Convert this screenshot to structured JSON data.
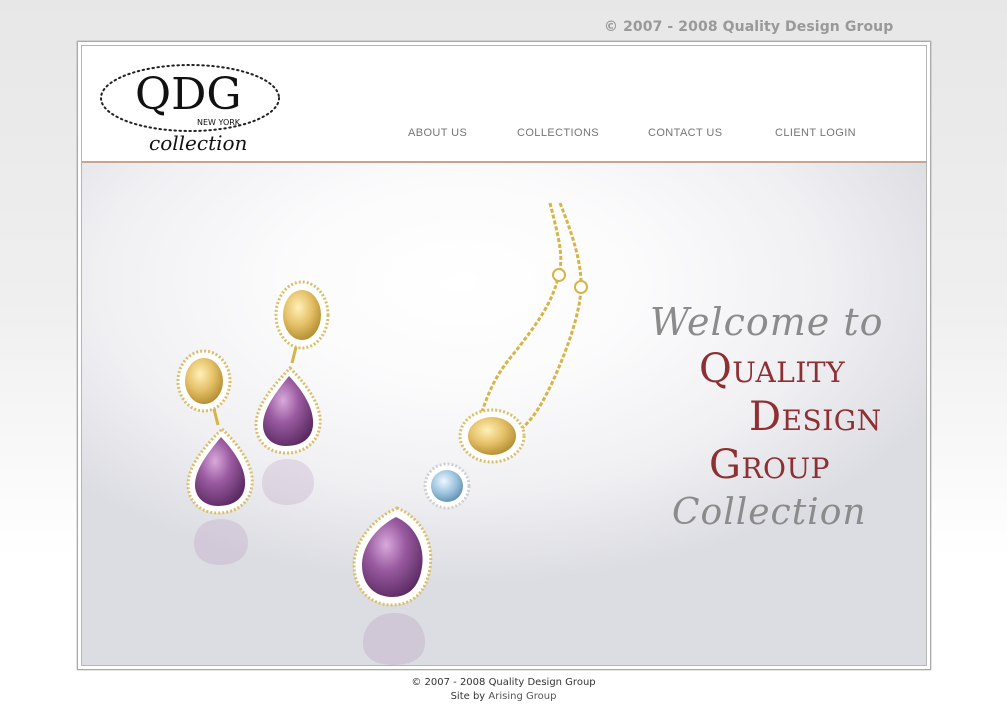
{
  "top_copyright": "© 2007 - 2008 Quality Design Group",
  "logo": {
    "letters": "QDG",
    "city": "NEW YORK",
    "sub": "collection"
  },
  "nav": [
    {
      "label": "ABOUT US"
    },
    {
      "label": "COLLECTIONS"
    },
    {
      "label": "CONTACT US"
    },
    {
      "label": "CLIENT LOGIN"
    }
  ],
  "hero": {
    "line1": "Welcome to",
    "line2": {
      "cap": "Q",
      "rest": "uality"
    },
    "line3": {
      "cap": "D",
      "rest": "esign"
    },
    "line4": {
      "cap": "G",
      "rest": "roup"
    },
    "line5": "Collection"
  },
  "footer": {
    "copyright": "© 2007 - 2008 Quality Design Group",
    "site_by_prefix": "Site by",
    "site_by_link": "Arising Group"
  },
  "colors": {
    "accent": "#8e3033",
    "rule": "#c8a38e",
    "nav_text": "#757575",
    "gold": "#d8b94a",
    "amethyst": "#8a4a8e",
    "citrine": "#e8c66a",
    "topaz": "#a6c9e0"
  }
}
